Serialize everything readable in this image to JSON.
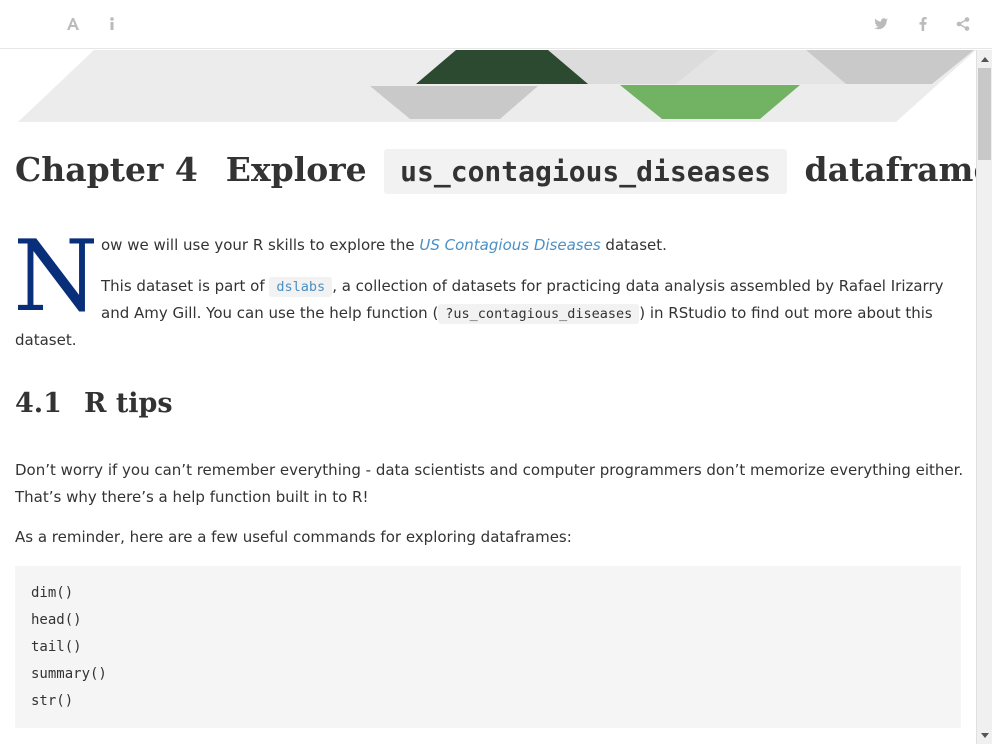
{
  "toolbar": {
    "left_icons": [
      "font-icon",
      "info-icon"
    ],
    "right_icons": [
      "twitter-icon",
      "facebook-icon",
      "share-icon"
    ]
  },
  "colors": {
    "banner_dark_green": "#2b4a2f",
    "banner_light_green": "#72b263",
    "banner_gray": "#c9c9c9",
    "dropcap_blue": "#0a2f7a",
    "link": "#4a90c4"
  },
  "chapter": {
    "number": "Chapter 4",
    "title_pre": "Explore",
    "title_code": "us_contagious_diseases",
    "title_post": "dataframe"
  },
  "intro": {
    "dropcap_letter": "N",
    "text_pre": "ow we will use your R skills to explore the ",
    "link_text": "US Contagious Diseases",
    "text_post": " dataset."
  },
  "para2": {
    "text1": "This dataset is part of ",
    "code1": "dslabs",
    "text2": ", a collection of datasets for practicing data analysis assembled by Rafael Irizarry",
    "text3": "and Amy Gill. You can use the help function (",
    "code2": "?us_contagious_diseases",
    "text4": ") in RStudio to find out more about this",
    "text5": "dataset."
  },
  "section": {
    "number": "4.1",
    "title": "R tips"
  },
  "para3": {
    "line1": "Don’t worry if you can’t remember everything - data scientists and computer programmers don’t memorize everything either.",
    "line2": "That’s why there’s a help function built in to R!"
  },
  "para4": "As a reminder, here are a few useful commands for exploring dataframes:",
  "code_lines": [
    "dim()",
    "head()",
    "tail()",
    "summary()",
    "str()"
  ]
}
